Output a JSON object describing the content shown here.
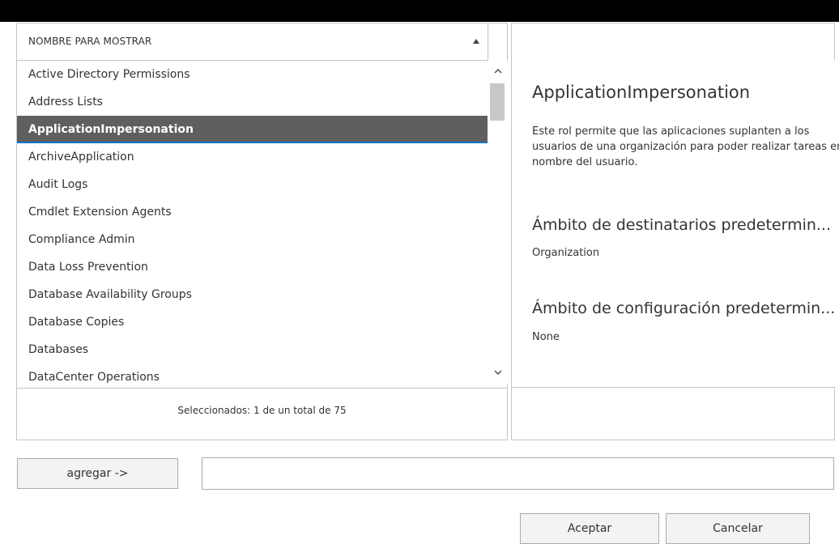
{
  "list": {
    "column_header": "NOMBRE PARA MOSTRAR",
    "items": [
      {
        "label": "Active Directory Permissions"
      },
      {
        "label": "Address Lists"
      },
      {
        "label": "ApplicationImpersonation",
        "selected": true
      },
      {
        "label": "ArchiveApplication"
      },
      {
        "label": "Audit Logs"
      },
      {
        "label": "Cmdlet Extension Agents"
      },
      {
        "label": "Compliance Admin"
      },
      {
        "label": "Data Loss Prevention"
      },
      {
        "label": "Database Availability Groups"
      },
      {
        "label": "Database Copies"
      },
      {
        "label": "Databases"
      },
      {
        "label": "DataCenter Operations"
      }
    ],
    "footer": "Seleccionados: 1 de un total de 75"
  },
  "detail": {
    "title": "ApplicationImpersonation",
    "description": "Este rol permite que las aplicaciones suplanten a los usuarios de una organización para poder realizar tareas en nombre del usuario.",
    "recipient_scope_label": "Ámbito de destinatarios predetermin...",
    "recipient_scope_value": "Organization",
    "config_scope_label": "Ámbito de configuración predetermin...",
    "config_scope_value": "None"
  },
  "actions": {
    "add_label": "agregar ->",
    "add_field_value": "",
    "ok_label": "Aceptar",
    "cancel_label": "Cancelar"
  },
  "icons": {
    "sort": "sort-ascending-icon",
    "scroll_up": "chevron-up-icon",
    "scroll_down": "chevron-down-icon"
  },
  "colors": {
    "selected_bg": "#5f5f5f",
    "selected_underline": "#0a74c9",
    "border": "#c6c6c6"
  }
}
